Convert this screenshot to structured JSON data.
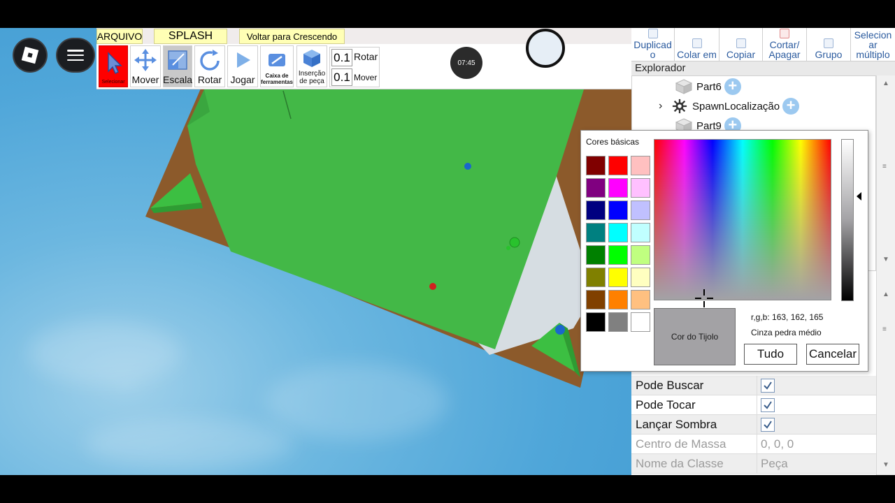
{
  "menu": {
    "arquivo": "ARQUIVO",
    "splash": "SPLASH",
    "voltar": "Voltar para Crescendo"
  },
  "toolbar": {
    "selecionar": "Selecionar",
    "mover": "Mover",
    "escala": "Escala",
    "rotar": "Rotar",
    "jogar": "Jogar",
    "caixa": "Caixa de ferramentas",
    "insercao": "Inserção de peça",
    "rotate_step": "0.1",
    "rotate_label": "Rotar",
    "move_step": "0.1",
    "move_label": "Mover"
  },
  "timer": "07:45",
  "actions": {
    "duplicado": "Duplicad o",
    "colar": "Colar em",
    "copiar": "Copiar",
    "cortar": "Cortar/ Apagar",
    "grupo": "Grupo",
    "selecionar_multiplo": "Selecion ar múltiplo"
  },
  "explorer": {
    "title": "Explorador",
    "items": [
      {
        "label": "Part6",
        "icon": "part-icon"
      },
      {
        "label": "SpawnLocalização",
        "icon": "spawn-icon"
      },
      {
        "label": "Part9",
        "icon": "part-icon"
      }
    ]
  },
  "properties": [
    {
      "name": "Pode Buscar",
      "checked": true,
      "value": "",
      "dim": false
    },
    {
      "name": "Pode Tocar",
      "checked": true,
      "value": "",
      "dim": false
    },
    {
      "name": "Lançar Sombra",
      "checked": true,
      "value": "",
      "dim": false
    },
    {
      "name": "Centro de Massa",
      "checked": null,
      "value": "0, 0, 0",
      "dim": true
    },
    {
      "name": "Nome da Classe",
      "checked": null,
      "value": "Peça",
      "dim": true
    }
  ],
  "color_dialog": {
    "basic_title": "Cores básicas",
    "swatches": [
      "#800000",
      "#ff0000",
      "#ffc0c0",
      "#800080",
      "#ff00ff",
      "#ffc0ff",
      "#000080",
      "#0000ff",
      "#c0c0ff",
      "#008080",
      "#00ffff",
      "#c0ffff",
      "#008000",
      "#00ff00",
      "#c0ff80",
      "#808000",
      "#ffff00",
      "#ffffc0",
      "#804000",
      "#ff8000",
      "#ffc080",
      "#000000",
      "#808080",
      "#ffffff"
    ],
    "preview_label": "Cor do Tijolo",
    "rgb_text": "r,g,b:  163, 162, 165",
    "color_name": "Cinza pedra médio",
    "ok_label": "Tudo",
    "cancel_label": "Cancelar",
    "current_color": "#a3a2a5"
  },
  "colors": {
    "grass": "#43b847",
    "dirt": "#8c5a2b",
    "sky": "#4fa6d9",
    "selected_tool": "#ff0000"
  }
}
